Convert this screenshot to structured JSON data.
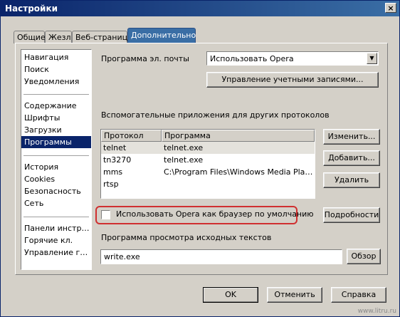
{
  "window": {
    "title": "Настройки",
    "close_glyph": "×"
  },
  "tabs": [
    "Общие",
    "Жезл",
    "Веб-страницы",
    "Дополнительно"
  ],
  "nav": {
    "group1": [
      "Навигация",
      "Поиск",
      "Уведомления"
    ],
    "group2": [
      "Содержание",
      "Шрифты",
      "Загрузки",
      "Программы"
    ],
    "group3": [
      "История",
      "Cookies",
      "Безопасность",
      "Сеть"
    ],
    "group4": [
      "Панели инструм...",
      "Горячие кл.",
      "Управление гол..."
    ],
    "selected": "Программы"
  },
  "email": {
    "label": "Программа эл. почты",
    "value": "Использовать Opera",
    "accounts_button": "Управление учетными записями..."
  },
  "protocols": {
    "label": "Вспомогательные приложения для других протоколов",
    "columns": [
      "Протокол",
      "Программа"
    ],
    "rows": [
      [
        "telnet",
        "telnet.exe"
      ],
      [
        "tn3270",
        "telnet.exe"
      ],
      [
        "mms",
        "C:\\Program Files\\Windows Media Player\\..."
      ],
      [
        "rtsp",
        ""
      ]
    ],
    "edit_button": "Изменить...",
    "add_button": "Добавить...",
    "delete_button": "Удалить"
  },
  "default_browser": {
    "label": "Использовать Opera как браузер по умолчанию",
    "checked": false,
    "details_button": "Подробности"
  },
  "source": {
    "label": "Программа просмотра исходных текстов",
    "value": "write.exe",
    "browse_button": "Обзор"
  },
  "footer": {
    "ok": "OK",
    "cancel": "Отменить",
    "help": "Справка"
  },
  "watermark": "www.litru.ru",
  "colors": {
    "title_bar": "#0a246a",
    "active_tab": "#3a6ea5",
    "highlight": "#d03030",
    "dialog_bg": "#d4d0c8"
  }
}
